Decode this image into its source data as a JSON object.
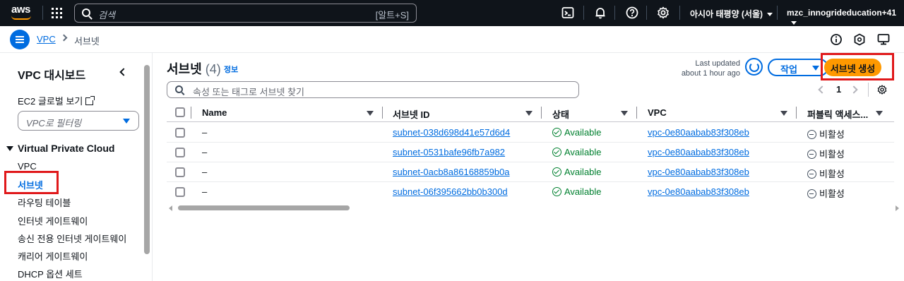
{
  "topnav": {
    "logo_text": "aws",
    "search_placeholder": "검색",
    "search_shortcut": "[알트+S]",
    "region": "아시아 태평양 (서울)",
    "account": "mzc_innogrideducation+41"
  },
  "breadcrumb": {
    "service": "VPC",
    "current": "서브넷"
  },
  "sidebar": {
    "title": "VPC 대시보드",
    "ec2_global_view": "EC2 글로벌 보기",
    "filter_placeholder": "VPC로 필터링",
    "section": "Virtual Private Cloud",
    "items": [
      "VPC",
      "서브넷",
      "라우팅 테이블",
      "인터넷 게이트웨이",
      "송신 전용 인터넷 게이트웨이",
      "캐리어 게이트웨이",
      "DHCP 옵션 세트"
    ],
    "active_item": "서브넷"
  },
  "main": {
    "title": "서브넷",
    "count": "(4)",
    "info": "정보",
    "last_updated_line1": "Last updated",
    "last_updated_line2": "about 1 hour ago",
    "action_label": "작업",
    "create_label": "서브넷 생성",
    "filter_placeholder": "속성 또는 태그로 서브넷 찾기",
    "page": "1"
  },
  "table": {
    "columns": [
      "Name",
      "서브넷 ID",
      "상태",
      "VPC",
      "퍼블릭 액세스..."
    ],
    "rows": [
      {
        "name": "–",
        "subnet_id": "subnet-038d698d41e57d6d4",
        "state": "Available",
        "vpc": "vpc-0e80aabab83f308eb",
        "public_access": "비활성"
      },
      {
        "name": "–",
        "subnet_id": "subnet-0531bafe96fb7a982",
        "state": "Available",
        "vpc": "vpc-0e80aabab83f308eb",
        "public_access": "비활성"
      },
      {
        "name": "–",
        "subnet_id": "subnet-0acb8a86168859b0a",
        "state": "Available",
        "vpc": "vpc-0e80aabab83f308eb",
        "public_access": "비활성"
      },
      {
        "name": "–",
        "subnet_id": "subnet-06f395662bb0b300d",
        "state": "Available",
        "vpc": "vpc-0e80aabab83f308eb",
        "public_access": "비활성"
      }
    ]
  },
  "colors": {
    "nav_bg": "#0f141a",
    "link": "#006ce0",
    "primary_button": "#ff9900",
    "available": "#00802f",
    "highlight": "#e0191b"
  }
}
